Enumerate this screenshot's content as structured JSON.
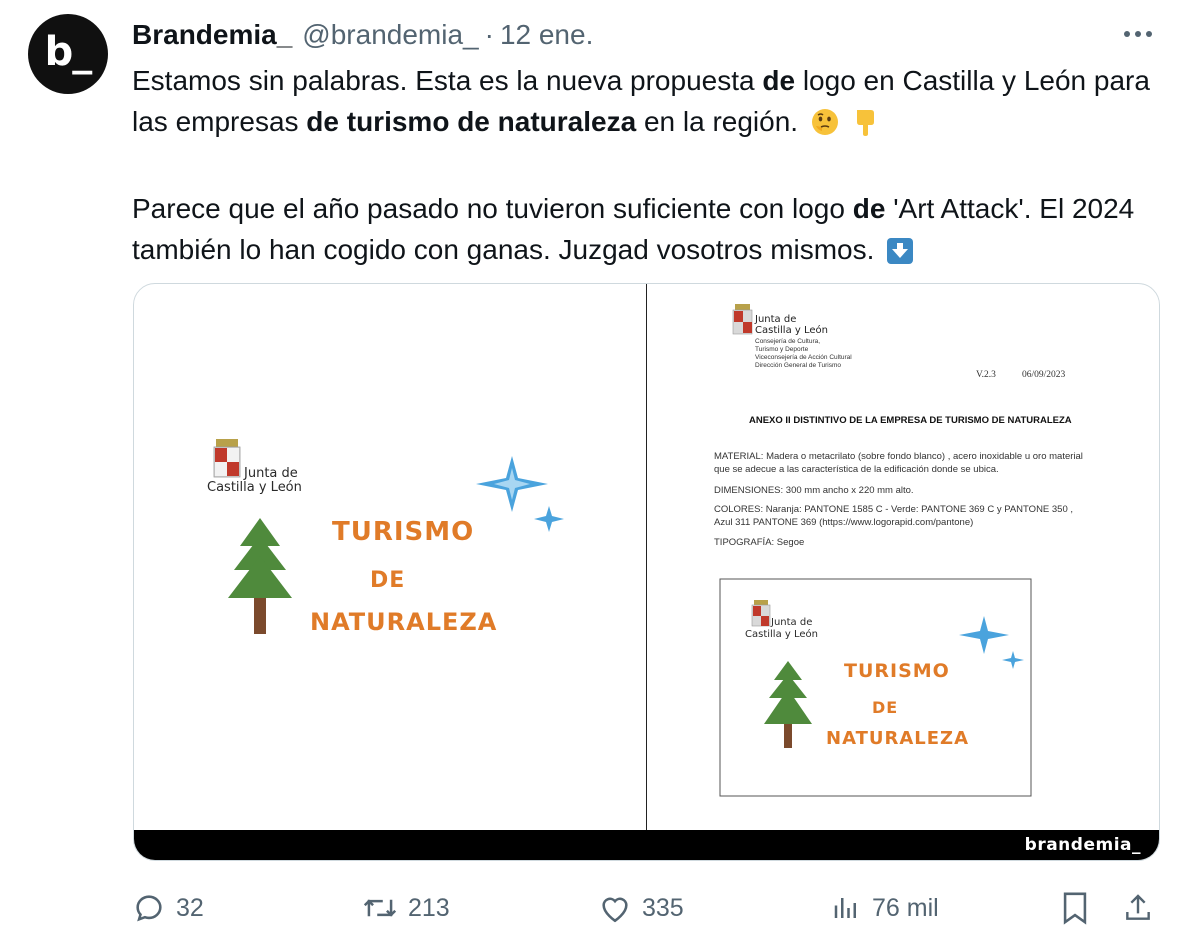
{
  "tweet": {
    "author_name": "Brandemia_",
    "author_handle": "@brandemia_",
    "separator": "·",
    "time": "12 ene.",
    "avatar_text": "b_",
    "text": {
      "p1_a": "Estamos sin palabras. Esta es la nueva propuesta ",
      "p1_b": "de",
      "p1_c": " logo en Castilla y León para las empresas ",
      "p1_d": "de turismo de naturaleza",
      "p1_e": " en la región.",
      "p2_a": "Parece que el año pasado no tuvieron suficiente con logo ",
      "p2_b": "de",
      "p2_c": " 'Art Attack'. El 2024 también lo han cogido con ganas. Juzgad vosotros mismos."
    },
    "emojis": [
      "thinking-face",
      "backhand-index-pointing-down",
      "down-arrow"
    ]
  },
  "media": {
    "left": {
      "org_line1": "Junta de",
      "org_line2": "Castilla y León",
      "title_line1": "TURISMO",
      "title_line2": "DE",
      "title_line3": "NATURALEZA"
    },
    "right": {
      "org_line1": "Junta de",
      "org_line2": "Castilla y León",
      "org_sub1": "Consejería de Cultura,",
      "org_sub2": "Turismo y Deporte",
      "org_sub3": "Viceconsejería de Acción Cultural",
      "org_sub4": "Dirección General de Turismo",
      "version": "V.2.3",
      "date": "06/09/2023",
      "heading": "ANEXO II DISTINTIVO DE LA EMPRESA DE TURISMO DE NATURALEZA",
      "material_1": "MATERIAL: Madera o metacrilato (sobre fondo blanco) , acero inoxidable u oro material",
      "material_2": "que se adecue a las característica de la edificación donde se ubica.",
      "dimensiones": "DIMENSIONES: 300 mm ancho x 220 mm alto.",
      "colores_1": "COLORES: Naranja: PANTONE 1585 C - Verde: PANTONE 369 C y PANTONE 350 ,",
      "colores_2": "Azul 311 PANTONE 369 (https://www.logorapid.com/pantone)",
      "tipografia": "TIPOGRAFÍA: Segoe",
      "box_org_line1": "Junta de",
      "box_org_line2": "Castilla y León",
      "box_title_line1": "TURISMO",
      "box_title_line2": "DE",
      "box_title_line3": "NATURALEZA"
    },
    "watermark": "brandemia_"
  },
  "actions": {
    "replies": "32",
    "reposts": "213",
    "likes": "335",
    "views": "76 mil"
  },
  "colors": {
    "text": "#0f1419",
    "secondary": "#536471",
    "orange": "#e07b28",
    "green": "#4a8a3a",
    "blue": "#4aa3dd"
  }
}
